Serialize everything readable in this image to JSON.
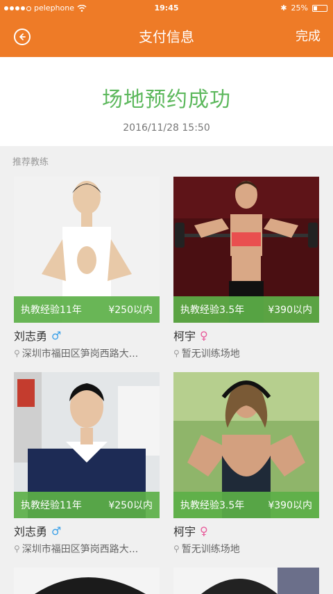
{
  "status_bar": {
    "carrier": "pelephone",
    "time": "19:45",
    "battery": "25%",
    "battery_level": 0.25
  },
  "header": {
    "title": "支付信息",
    "done_label": "完成"
  },
  "success": {
    "message": "场地预约成功",
    "datetime": "2016/11/28 15:50"
  },
  "section_label": "推荐教练",
  "coaches": [
    {
      "experience": "执教经验11年",
      "price": "¥250以内",
      "name": "刘志勇",
      "gender": "male",
      "gender_symbol": "♂",
      "location": "深圳市福田区笋岗西路大..."
    },
    {
      "experience": "执教经验3.5年",
      "price": "¥390以内",
      "name": "柯宇",
      "gender": "female",
      "gender_symbol": "♀",
      "location": "暂无训练场地"
    },
    {
      "experience": "执教经验11年",
      "price": "¥250以内",
      "name": "刘志勇",
      "gender": "male",
      "gender_symbol": "♂",
      "location": "深圳市福田区笋岗西路大..."
    },
    {
      "experience": "执教经验3.5年",
      "price": "¥390以内",
      "name": "柯宇",
      "gender": "female",
      "gender_symbol": "♀",
      "location": "暂无训练场地"
    }
  ],
  "colors": {
    "header": "#ee7b27",
    "success_text": "#5cb85c",
    "badge": "#5cb048"
  }
}
